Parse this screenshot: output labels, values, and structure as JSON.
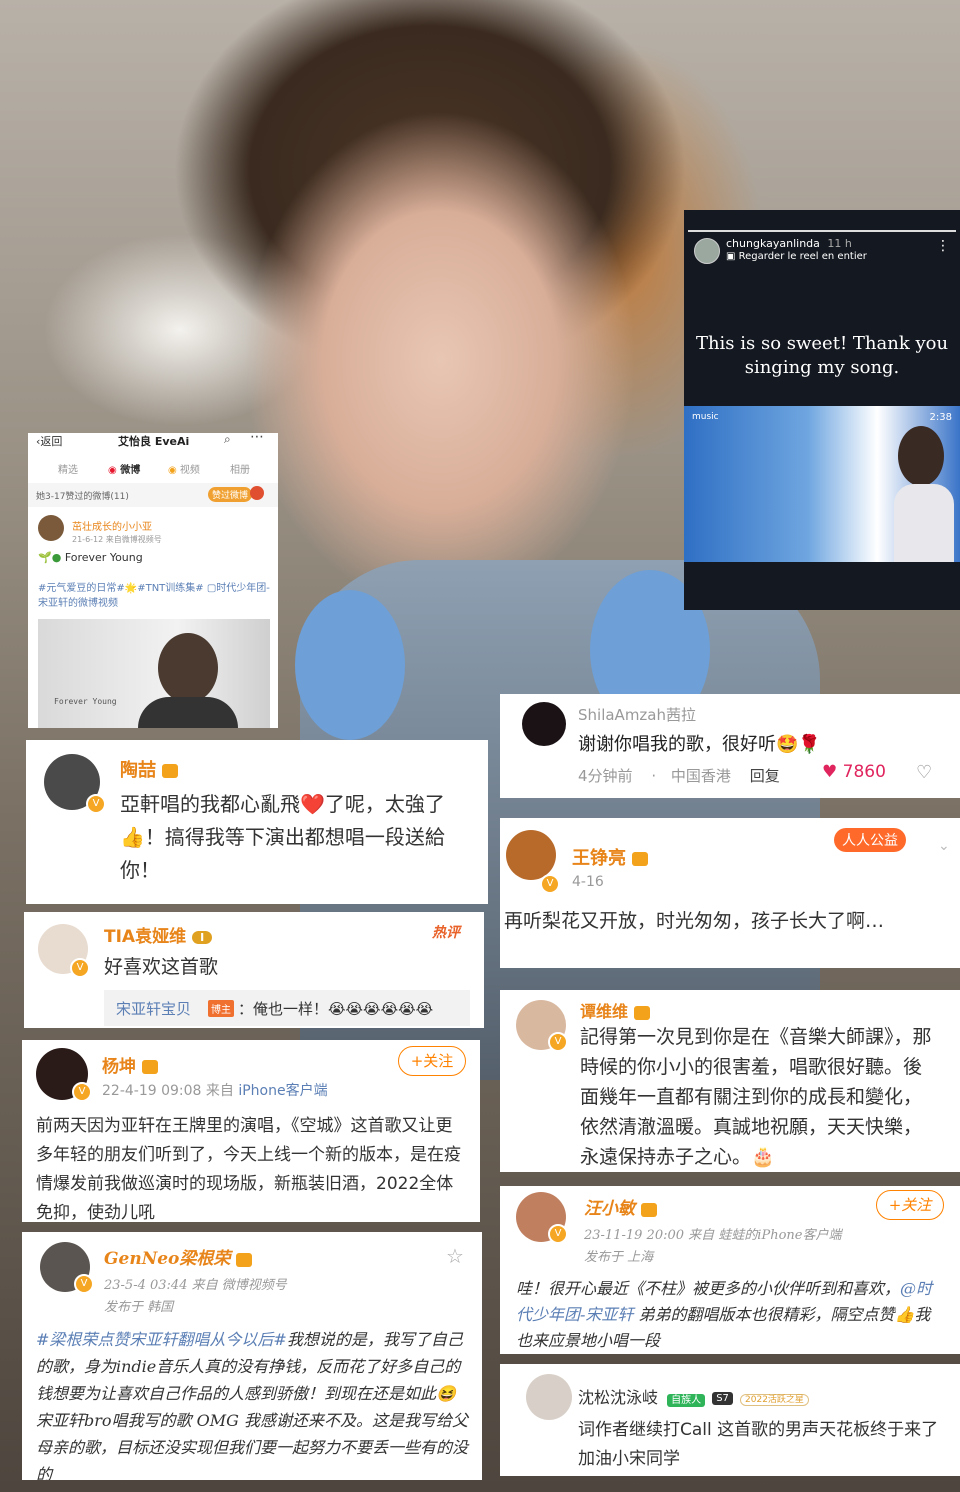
{
  "weibo_profile": {
    "back": "返回",
    "title": "艾怡良 EveAi",
    "tabs": [
      "精选",
      "微博",
      "视频",
      "相册"
    ],
    "liked_header": "她3-17赞过的微博(11)",
    "liked_tag": "赞过微博",
    "poster": "茁壮成长的小小亚",
    "post_meta": "21-6-12 来自微博视频号",
    "post_text": "Forever Young",
    "hashtags": "#元气爱豆的日常#🌟#TNT训练集# ▢时代少年团-宋亚轩的微博视频",
    "video_caption": "Forever Young"
  },
  "ig_story": {
    "username": "chungkayanlinda",
    "time": "11 h",
    "reel_link": "Regarder le reel en entier",
    "message": "This is so sweet!  Thank you singing my song.",
    "video_time": "2:38",
    "video_source": "music"
  },
  "comments": {
    "taozhe": {
      "name": "陶喆",
      "text": "亞軒唱的我都心亂飛❤️了呢，太強了👍！搞得我等下演出都想唱一段送給你！"
    },
    "shila": {
      "name": "ShilaAmzah茜拉",
      "text": "谢谢你唱我的歌，很好听🤩🌹",
      "time": "4分钟前",
      "location": "中国香港",
      "reply": "回复",
      "likes": "7860"
    },
    "wangzhengliang": {
      "name": "王铮亮",
      "date": "4-16",
      "badge": "人人公益",
      "text": "再听梨花又开放，时光匆匆，孩子长大了啊…"
    },
    "tia": {
      "name": "TIA袁娅维",
      "level": "I",
      "hot": "热评",
      "text": "好喜欢这首歌",
      "reply_name": "宋亚轩宝贝",
      "reply_tag": "博主",
      "reply_text": "：俺也一样！😭😭😭😭😭😭"
    },
    "tanweiwei": {
      "name": "谭维维",
      "text": "記得第一次見到你是在《音樂大師課》，那時候的你小小的很害羞，唱歌很好聽。後面幾年一直都有關注到你的成長和變化，依然清澈溫暖。真誠地祝願，天天快樂，永遠保持赤子之心。🎂"
    },
    "yangkun": {
      "name": "杨坤",
      "follow": "+关注",
      "date": "22-4-19 09:08",
      "source_prefix": "来自",
      "source": "iPhone客户端",
      "text": "前两天因为亚轩在王牌里的演唱，《空城》这首歌又让更多年轻的朋友们听到了，今天上线一个新的版本，是在疫情爆发前我做巡演时的现场版，新瓶装旧酒，2022全体免抑，使劲儿吼"
    },
    "wangxiaomin": {
      "name": "汪小敏",
      "follow": "+关注",
      "date": "23-11-19 20:00",
      "source": "来自 蛙蛙的iPhone客户端",
      "location": "发布于 上海",
      "text_before": "哇！很开心最近《不柱》被更多的小伙伴听到和喜欢，",
      "mention": "@时代少年团-宋亚轩",
      "text_after": " 弟弟的翻唱版本也很精彩，隔空点赞👍我也来应景地小唱一段"
    },
    "genneo": {
      "name": "GenNeo梁根荣",
      "date": "23-5-4 03:44",
      "source": "来自 微博视频号",
      "location": "发布于 韩国",
      "hashtag": "#梁根荣点赞宋亚轩翻唱从今以后#",
      "text": "我想说的是，我写了自己的歌，身为indie音乐人真的没有挣钱，反而花了好多自己的钱想要为让喜欢自己作品的人感到骄傲！到现在还是如此😆 宋亚轩bro唱我写的歌 OMG 我感谢还来不及。这是我写给父母亲的歌，目标还没实现但我们要一起努力不要丢一些有的没的"
    },
    "shensong": {
      "name": "沈松沈泳岐",
      "badge1": "自族人",
      "badge2": "S7",
      "badge3": "2022活跃之星",
      "text": "词作者继续打Call 这首歌的男声天花板终于来了 加油小宋同学"
    }
  }
}
